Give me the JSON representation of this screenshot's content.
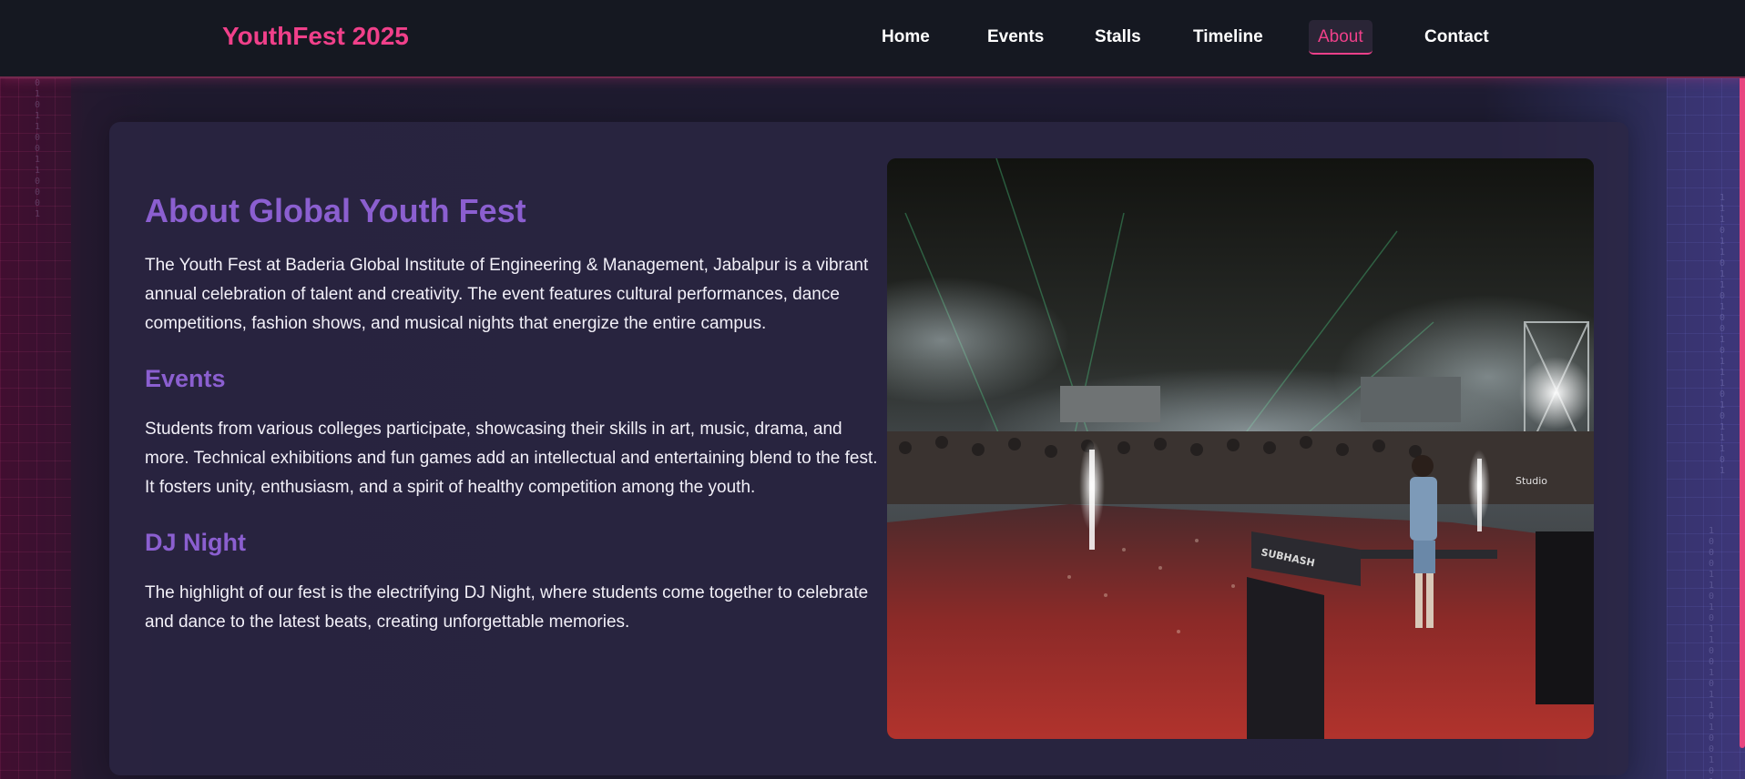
{
  "brand": {
    "title": "YouthFest 2025",
    "color": "#f0408a"
  },
  "nav": {
    "items": [
      {
        "label": "Home"
      },
      {
        "label": "Events"
      },
      {
        "label": "Stalls"
      },
      {
        "label": "Timeline"
      },
      {
        "label": "About",
        "active": true
      },
      {
        "label": "Contact"
      }
    ]
  },
  "about": {
    "title": "About Global Youth Fest",
    "intro": "The Youth Fest at Baderia Global Institute of Engineering & Management, Jabalpur is a vibrant annual celebration of talent and creativity. The event features cultural performances, dance competitions, fashion shows, and musical nights that energize the entire campus.",
    "sections": [
      {
        "heading": "Events",
        "body": "Students from various colleges participate, showcasing their skills in art, music, drama, and more. Technical exhibitions and fun games add an intellectual and entertaining blend to the fest. It fosters unity, enthusiasm, and a spirit of healthy competition among the youth."
      },
      {
        "heading": "DJ Night",
        "body": "The highlight of our fest is the electrifying DJ Night, where students come together to celebrate and dance to the latest beats, creating unforgettable memories."
      }
    ],
    "photo": {
      "subject": "dj-night-crowd-photo",
      "stage_sign": "SUBHASH",
      "watermark": "Studio"
    }
  },
  "colors": {
    "accent_pink": "#f0408a",
    "heading_purple": "#8b5fd0",
    "header_bg": "#151821"
  }
}
